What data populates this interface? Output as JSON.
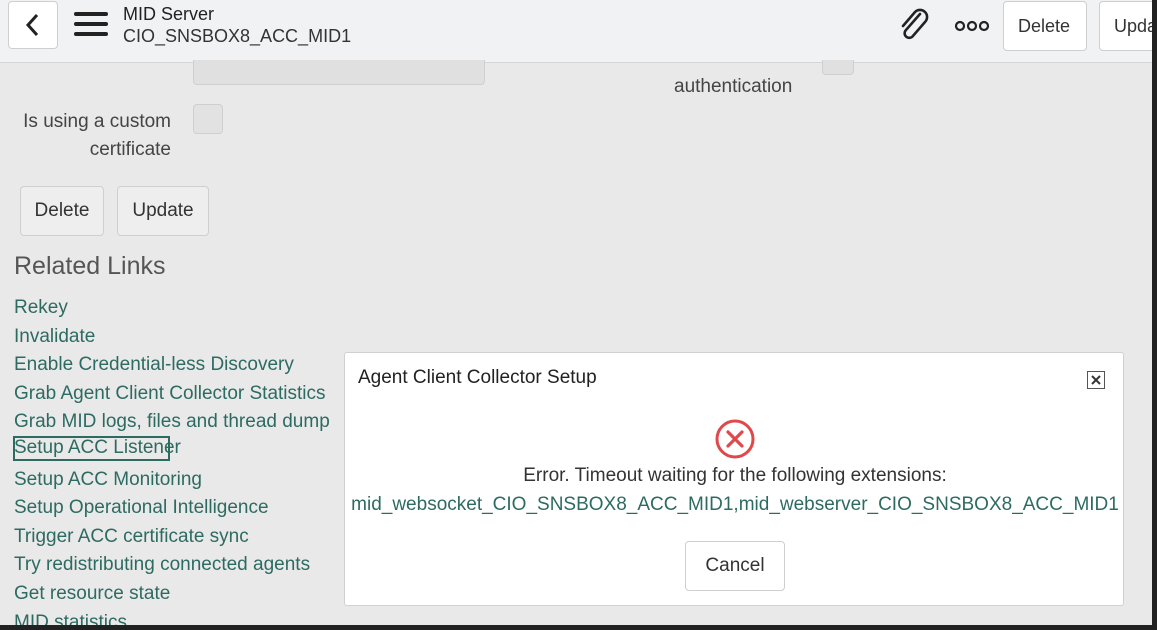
{
  "header": {
    "title": "MID Server",
    "subtitle": "CIO_SNSBOX8_ACC_MID1",
    "delete_label": "Delete",
    "update_label": "Upda"
  },
  "form": {
    "authentication_label": "authentication",
    "custom_cert_label_line1": "Is using a custom",
    "custom_cert_label_line2": "certificate",
    "delete_label": "Delete",
    "update_label": "Update"
  },
  "related_links": {
    "heading": "Related Links",
    "items": [
      {
        "label": "Rekey"
      },
      {
        "label": "Invalidate"
      },
      {
        "label": "Enable Credential-less Discovery"
      },
      {
        "label": "Grab Agent Client Collector Statistics"
      },
      {
        "label": "Grab MID logs, files and thread dump"
      },
      {
        "label": "Setup ACC Listener",
        "focused": true
      },
      {
        "label": "Setup ACC Monitoring"
      },
      {
        "label": "Setup Operational Intelligence"
      },
      {
        "label": "Trigger ACC certificate sync"
      },
      {
        "label": "Try redistributing connected agents"
      },
      {
        "label": "Get resource state"
      },
      {
        "label": "MID statistics"
      }
    ]
  },
  "modal": {
    "title": "Agent Client Collector Setup",
    "error_message": "Error. Timeout waiting for the following extensions:",
    "extensions": "mid_websocket_CIO_SNSBOX8_ACC_MID1,mid_webserver_CIO_SNSBOX8_ACC_MID1",
    "cancel_label": "Cancel"
  },
  "icons": {
    "back": "chevron-left-icon",
    "menu": "hamburger-menu-icon",
    "attachment": "paperclip-icon",
    "more": "more-options-icon",
    "close": "close-icon",
    "error": "error-circle-icon"
  },
  "colors": {
    "link": "#2d6b62",
    "error": "#e0484a",
    "background": "#e9e9e9"
  }
}
